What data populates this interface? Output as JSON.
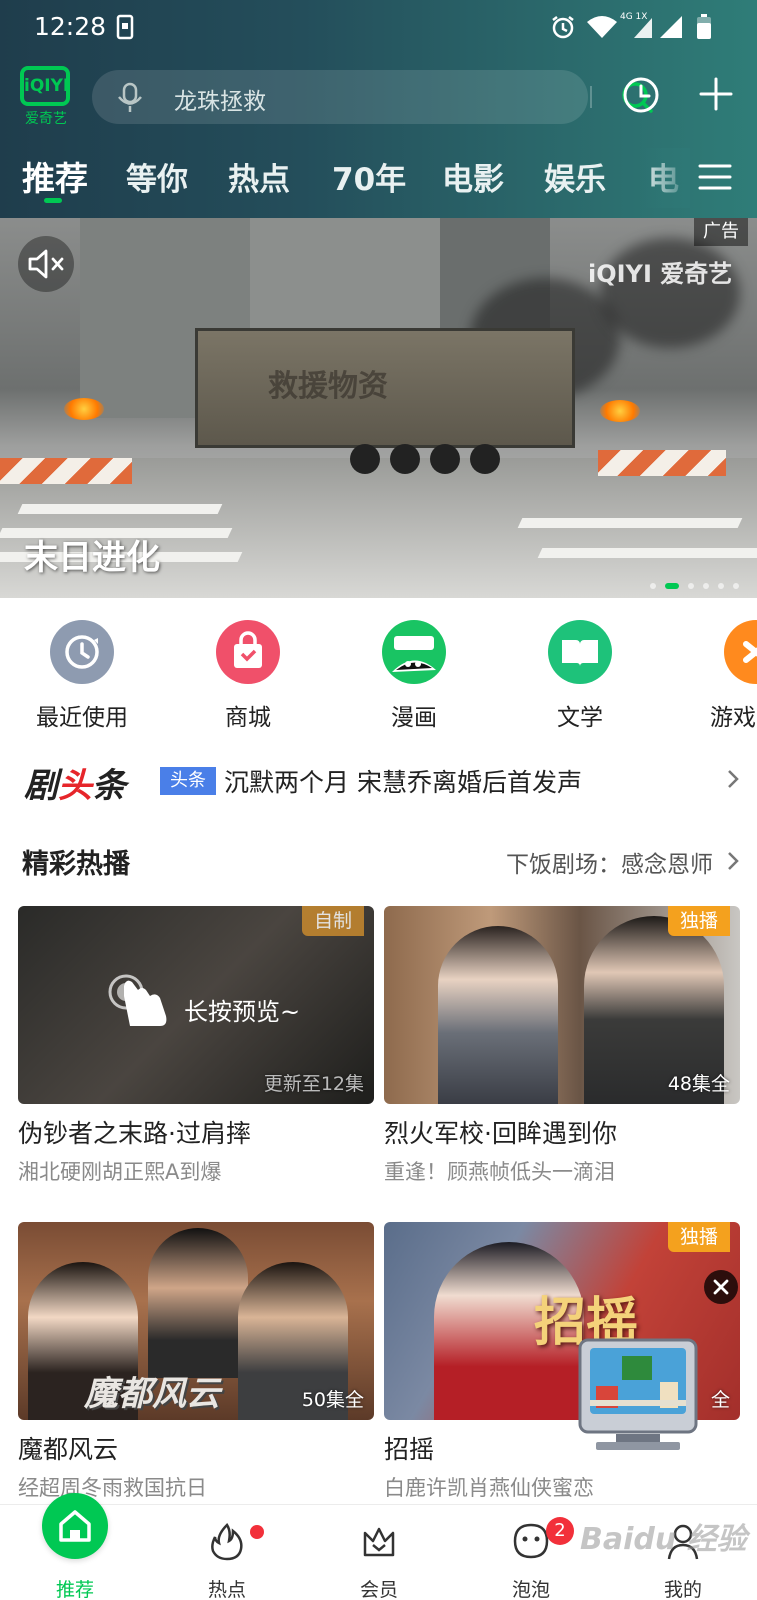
{
  "status_bar": {
    "time": "12:28",
    "network_badge": "4G 1X"
  },
  "header": {
    "logo_text": "iQIYI",
    "logo_sub": "爱奇艺",
    "search": {
      "placeholder": "龙珠拯救"
    }
  },
  "tabs": [
    {
      "label": "推荐",
      "active": true
    },
    {
      "label": "等你"
    },
    {
      "label": "热点"
    },
    {
      "label": "70年"
    },
    {
      "label": "电影"
    },
    {
      "label": "娱乐"
    },
    {
      "label": "电"
    }
  ],
  "banner": {
    "ad_label": "广告",
    "watermark": "iQIYI 爱奇艺",
    "title": "末日进化",
    "truck_text": "救援物资"
  },
  "shortcuts": [
    {
      "label": "最近使用",
      "icon": "recent-clock-icon",
      "color": "#8e9bb0"
    },
    {
      "label": "商城",
      "icon": "shopping-bag-icon",
      "color": "#f0506a"
    },
    {
      "label": "漫画",
      "icon": "comic-icon",
      "color": "#19c463"
    },
    {
      "label": "文学",
      "icon": "book-icon",
      "color": "#1ec27a"
    },
    {
      "label": "游戏",
      "icon": "game-icon",
      "color": "#ff8a1e"
    }
  ],
  "headline": {
    "logo_a": "剧",
    "logo_b": "头",
    "logo_c": "条",
    "tag": "头条",
    "text": "沉默两个月 宋慧乔离婚后首发声"
  },
  "section": {
    "title": "精彩热播",
    "more": "下饭剧场：感念恩师"
  },
  "cards": [
    {
      "badge": "自制",
      "badge_color": "#c88a2e",
      "episodes": "更新至12集",
      "overlay": "长按预览~",
      "title": "伪钞者之末路·过肩摔",
      "subtitle": "湘北硬刚胡正熙A到爆"
    },
    {
      "badge": "独播",
      "badge_color": "#f4a11e",
      "episodes": "48集全",
      "title": "烈火军校·回眸遇到你",
      "subtitle": "重逢！顾燕帧低头一滴泪"
    },
    {
      "episodes": "50集全",
      "poster_text": "魔都风云",
      "title": "魔都风云",
      "subtitle": "经超周冬雨救国抗日"
    },
    {
      "badge": "独播",
      "badge_color": "#f4a11e",
      "episodes": "全",
      "poster_text": "招摇",
      "title": "招摇",
      "subtitle": "白鹿许凯肖燕仙侠蜜恋"
    }
  ],
  "bottom_nav": [
    {
      "label": "推荐",
      "active": true
    },
    {
      "label": "热点",
      "dot": true
    },
    {
      "label": "会员"
    },
    {
      "label": "泡泡",
      "count": "2"
    },
    {
      "label": "我的"
    }
  ],
  "watermark_text": "Baidu 经验"
}
